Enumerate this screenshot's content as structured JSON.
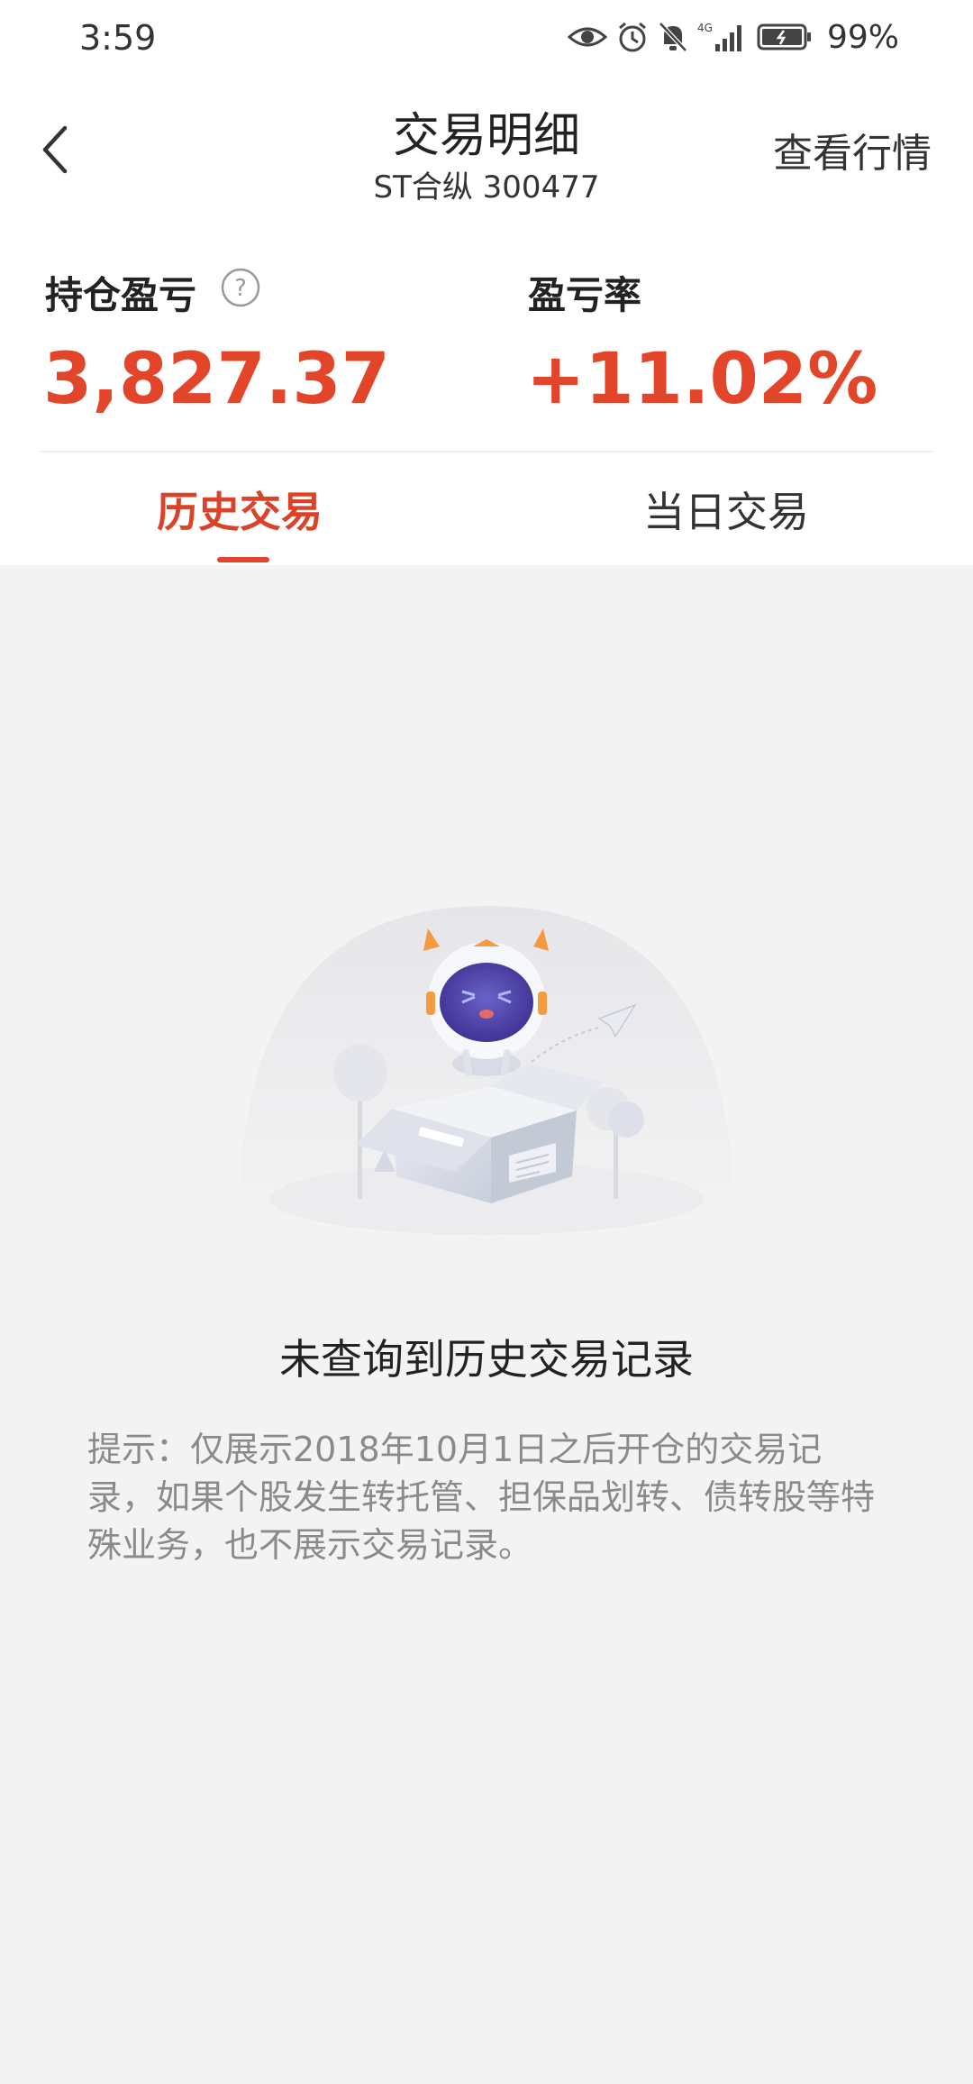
{
  "status_bar": {
    "time": "3:59",
    "network": "4G",
    "battery_percent": "99%"
  },
  "nav": {
    "title": "交易明细",
    "subtitle": "ST合纵  300477",
    "right_action": "查看行情"
  },
  "summary": {
    "position_pnl_label": "持仓盈亏",
    "position_pnl_value": "3,827.37",
    "pnl_rate_label": "盈亏率",
    "pnl_rate_value": "+11.02%"
  },
  "tabs": [
    {
      "label": "历史交易",
      "active": true
    },
    {
      "label": "当日交易",
      "active": false
    }
  ],
  "empty_state": {
    "title": "未查询到历史交易记录",
    "hint": "提示：仅展示2018年10月1日之后开仓的交易记录，如果个股发生转托管、担保品划转、债转股等特殊业务，也不展示交易记录。"
  },
  "colors": {
    "accent": "#e2452a",
    "background": "#f3f3f3"
  }
}
